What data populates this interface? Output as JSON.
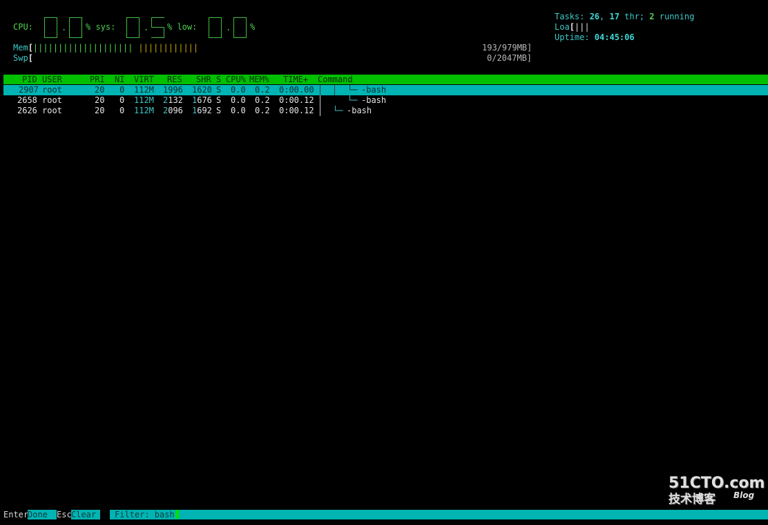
{
  "meters": {
    "cpu_label": "CPU:",
    "cpu_sep_dot1": ".",
    "sys_label": "% sys:",
    "sys_sep_dot": ".",
    "low_label": "% low:",
    "low_sep_dot": ".",
    "pct_end": "%",
    "mem_label": "Mem",
    "mem_bracket_open": "[",
    "mem_bar_green": "||||||||||||||||||||",
    "mem_bar_yellow": "||||||||||||",
    "mem_value": "193/979MB]",
    "swp_label": "Swp",
    "swp_bracket_open": "[",
    "swp_value": "0/2047MB]"
  },
  "stats": {
    "tasks_label": "Tasks: ",
    "tasks_count": "26",
    "tasks_sep": ", ",
    "thr_count": "17",
    "thr_label": " thr; ",
    "running_count": "2",
    "running_label": " running",
    "load_label": "Loa",
    "load_bracket": "[",
    "load_bars": "|||",
    "uptime_label": "Uptime: ",
    "uptime_value": "04:45:06"
  },
  "table": {
    "columns": [
      "PID",
      "USER",
      "PRI",
      "NI",
      "VIRT",
      "RES",
      "SHR",
      "S",
      "CPU%",
      "MEM%",
      "TIME+",
      "Command"
    ],
    "rows": [
      {
        "pid": "2907",
        "user": "root",
        "pri": "20",
        "ni": "0",
        "virt": "112M",
        "res": "1996",
        "shr": "1620",
        "s": "S",
        "cpu": "0.0",
        "mem": "0.2",
        "time": "0:00.00",
        "tree": "└─",
        "cmd": "-bash",
        "selected": true
      },
      {
        "pid": "2658",
        "user": "root",
        "pri": "20",
        "ni": "0",
        "virt": "112M",
        "res_hi": "2",
        "res_rest": "132",
        "shr_hi": "1",
        "shr_rest": "676",
        "s": "S",
        "cpu": "0.0",
        "mem": "0.2",
        "time": "0:00.12",
        "tree": "└─",
        "cmd": "-bash"
      },
      {
        "pid": "2626",
        "user": "root",
        "pri": "20",
        "ni": "0",
        "virt": "112M",
        "res_hi": "2",
        "res_rest": "096",
        "shr_hi": "1",
        "shr_rest": "692",
        "s": "S",
        "cpu": "0.0",
        "mem": "0.2",
        "time": "0:00.12",
        "tree": "└─",
        "cmd": "-bash"
      }
    ]
  },
  "footer": {
    "enter_key": "Enter",
    "enter_action": "Done",
    "esc_key": "Esc",
    "esc_action": "Clear",
    "filter_label": "Filter: ",
    "filter_value": "bash"
  },
  "watermark": {
    "line1": "51CTO.com",
    "line2": "技术博客",
    "line3": "Blog"
  },
  "colors": {
    "header_bar": "#00c000",
    "selection": "#00b4b4",
    "meter_green": "#4ed34e",
    "meter_yellow": "#c8a800",
    "stat_cyan": "#3ed6d6"
  }
}
